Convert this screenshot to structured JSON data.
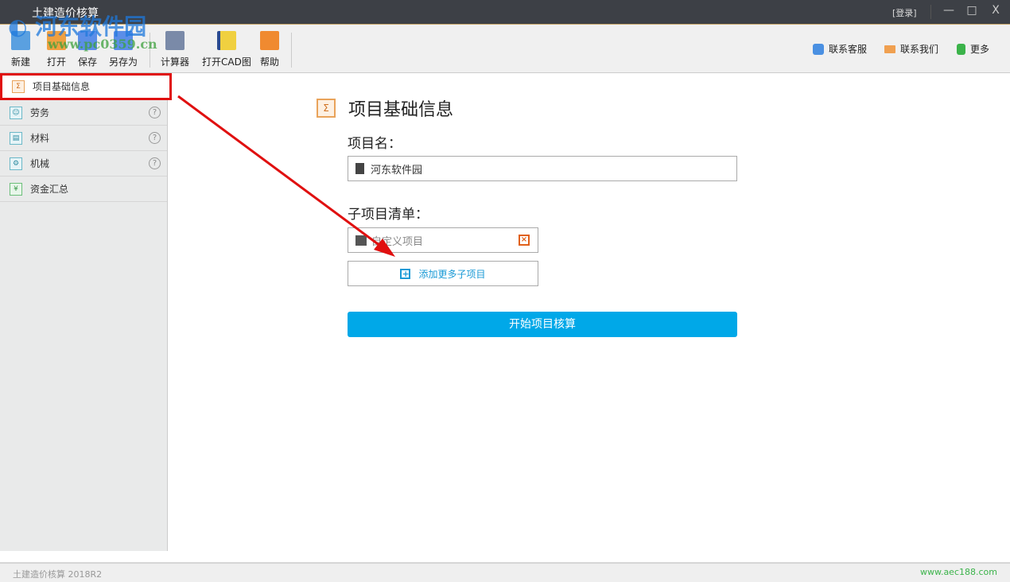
{
  "window": {
    "title": "土建造价核算",
    "login": "[登录]",
    "minimize": "—",
    "maximize": "□",
    "close": "X"
  },
  "toolbar": {
    "items": [
      {
        "label": "新建",
        "icon": "new-file-icon",
        "color": "#5aa0e0"
      },
      {
        "label": "打开",
        "icon": "open-folder-icon",
        "color": "#f0a040"
      },
      {
        "label": "保存",
        "icon": "save-icon",
        "color": "#5b8ee8"
      },
      {
        "label": "另存为",
        "icon": "save-as-icon",
        "color": "#5b8ee8"
      },
      {
        "label": "计算器",
        "icon": "calculator-icon",
        "color": "#7a8aa8"
      },
      {
        "label": "打开CAD图",
        "icon": "dwg-file-icon",
        "color": "#f0d040"
      },
      {
        "label": "帮助",
        "icon": "help-book-icon",
        "color": "#f08a30"
      }
    ],
    "right": [
      {
        "label": "联系客服",
        "icon": "qq-icon",
        "color": "#4a90e2"
      },
      {
        "label": "联系我们",
        "icon": "mail-icon",
        "color": "#f0a050"
      },
      {
        "label": "更多",
        "icon": "download-arrow-icon",
        "color": "#3bb34a"
      }
    ]
  },
  "sidebar": {
    "items": [
      {
        "label": "项目基础信息",
        "icon": "sigma-icon",
        "active": true
      },
      {
        "label": "劳务",
        "icon": "person-icon",
        "help": "?"
      },
      {
        "label": "材料",
        "icon": "paint-roller-icon",
        "help": "?"
      },
      {
        "label": "机械",
        "icon": "gear-icon",
        "help": "?"
      },
      {
        "label": "资金汇总",
        "icon": "yen-coin-icon"
      }
    ]
  },
  "main": {
    "title": "项目基础信息",
    "project_name_label": "项目名：",
    "project_name_value": "河东软件园",
    "subproject_label": "子项目清单：",
    "subprojects": [
      {
        "placeholder": "自定义项目"
      }
    ],
    "add_button": "添加更多子项目",
    "start_button": "开始项目核算",
    "accent": "#00a8e8"
  },
  "status": {
    "left": "土建造价核算 2018R2",
    "right": "www.aec188.com"
  },
  "watermark": {
    "text": "河东软件园",
    "url": "www.pc0359.cn"
  },
  "annotation": {
    "highlight_color": "#e01010"
  }
}
